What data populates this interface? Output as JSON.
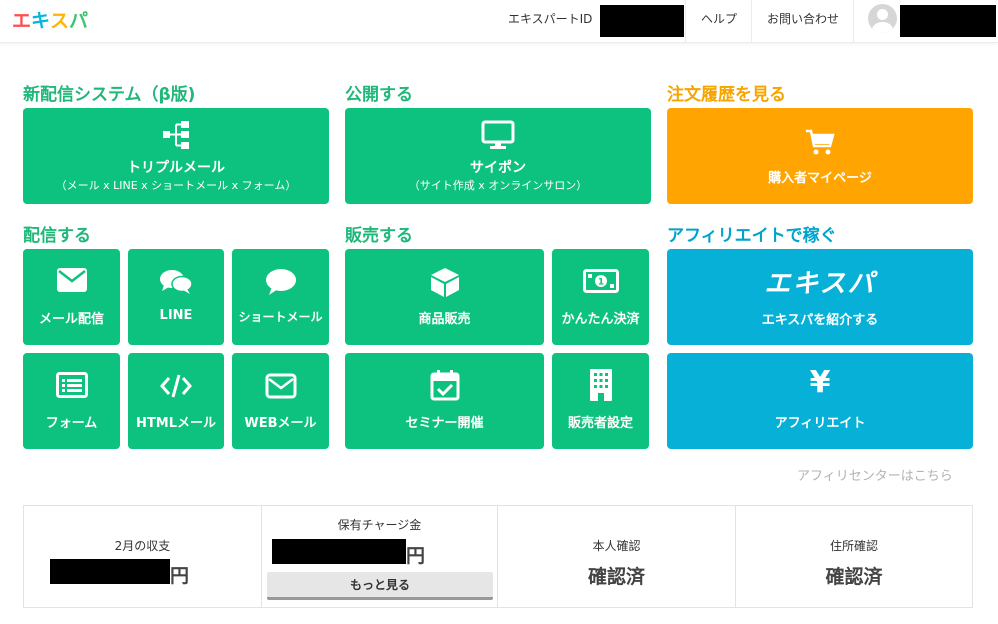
{
  "header": {
    "logo_chars": [
      "エ",
      "キ",
      "ス",
      "パ"
    ],
    "logo_colors": [
      "#ff4f4f",
      "#00b7de",
      "#ffb400",
      "#3cc46f"
    ],
    "expert_id_label": "エキスパートID",
    "help_label": "ヘルプ",
    "contact_label": "お問い合わせ"
  },
  "sections": {
    "triple": "新配信システム（β版)",
    "publish": "公開する",
    "orders": "注文履歴を見る",
    "deliver": "配信する",
    "sell": "販売する",
    "affiliate": "アフィリエイトで稼ぐ"
  },
  "tiles": {
    "triple_mail": {
      "label": "トリプルメール",
      "sub": "（メール x LINE x ショートメール x フォーム）",
      "icon": "sitemap-icon"
    },
    "saipon": {
      "label": "サイポン",
      "sub": "（サイト作成 x オンラインサロン）",
      "icon": "monitor-icon"
    },
    "buyer_page": {
      "label": "購入者マイページ",
      "icon": "cart-icon"
    },
    "mail": {
      "label": "メール配信",
      "icon": "envelope-icon"
    },
    "line": {
      "label": "LINE",
      "icon": "chat-bubbles-icon"
    },
    "short_mail": {
      "label": "ショートメール",
      "icon": "speech-bubble-icon"
    },
    "form": {
      "label": "フォーム",
      "icon": "list-form-icon"
    },
    "html_mail": {
      "label": "HTMLメール",
      "icon": "code-icon"
    },
    "web_mail": {
      "label": "WEBメール",
      "icon": "envelope-outline-icon"
    },
    "product_sale": {
      "label": "商品販売",
      "icon": "box-icon"
    },
    "kantan_payment": {
      "label": "かんたん決済",
      "icon": "money-icon"
    },
    "seminar": {
      "label": "セミナー開催",
      "icon": "calendar-check-icon"
    },
    "seller_settings": {
      "label": "販売者設定",
      "icon": "building-icon"
    },
    "introduce": {
      "label": "エキスパを紹介する",
      "logo_text": "エキスパ"
    },
    "affiliate": {
      "label": "アフィリエイト",
      "symbol": "¥"
    }
  },
  "affiliate_center_link": "アフィリセンターはこちら",
  "stats": {
    "month_income_label": "2月の収支",
    "yen": "円",
    "charge_label": "保有チャージ金",
    "more_button": "もっと見る",
    "identity_label": "本人確認",
    "identity_value": "確認済",
    "address_label": "住所確認",
    "address_value": "確認済"
  },
  "colors": {
    "green": "#0dc27f",
    "orange": "#ffa400",
    "blue": "#06b0d6"
  }
}
